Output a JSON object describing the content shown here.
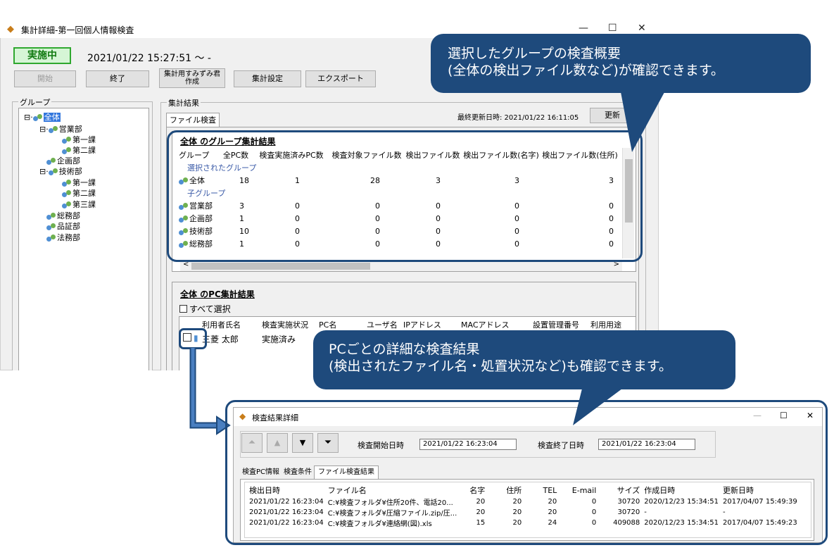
{
  "main_window": {
    "title": "集計詳細-第一回個人情報検査",
    "status": "実施中",
    "start_time": "2021/01/22 15:27:51 ～ -",
    "buttons": {
      "start": "開始",
      "end": "終了",
      "create": "集計用すみずみ君\n作成",
      "settings": "集計設定",
      "export": "エクスポート"
    },
    "group_label": "グループ",
    "tree": [
      {
        "label": "全体"
      },
      {
        "label": "営業部"
      },
      {
        "label": "第一課"
      },
      {
        "label": "第二課"
      },
      {
        "label": "企画部"
      },
      {
        "label": "技術部"
      },
      {
        "label": "第一課"
      },
      {
        "label": "第二課"
      },
      {
        "label": "第三課"
      },
      {
        "label": "総務部"
      },
      {
        "label": "品証部"
      },
      {
        "label": "法務部"
      }
    ],
    "results_label": "集計結果",
    "tab_file": "ファイル検査",
    "last_updated": "最終更新日時: 2021/01/22 16:11:05",
    "refresh": "更新",
    "group_section_title": "全体 のグループ集計結果",
    "group_table": {
      "headers": [
        "グループ",
        "全PC数",
        "検査実施済みPC数",
        "検査対象ファイル数",
        "検出ファイル数",
        "検出ファイル数(名字)",
        "検出ファイル数(住所)"
      ],
      "selected_label": "選択されたグループ",
      "selected_row": {
        "name": "全体",
        "cols": [
          "18",
          "1",
          "28",
          "3",
          "3",
          "3"
        ]
      },
      "child_label": "子グループ",
      "child_rows": [
        {
          "name": "営業部",
          "cols": [
            "3",
            "0",
            "0",
            "0",
            "0",
            "0"
          ]
        },
        {
          "name": "企画部",
          "cols": [
            "1",
            "0",
            "0",
            "0",
            "0",
            "0"
          ]
        },
        {
          "name": "技術部",
          "cols": [
            "10",
            "0",
            "0",
            "0",
            "0",
            "0"
          ]
        },
        {
          "name": "総務部",
          "cols": [
            "1",
            "0",
            "0",
            "0",
            "0",
            "0"
          ]
        }
      ]
    },
    "pc_section_title": "全体 のPC集計結果",
    "select_all": "すべて選択",
    "pc_table": {
      "headers": [
        "利用者氏名",
        "検査実施状況",
        "PC名",
        "ユーザ名",
        "IPアドレス",
        "MACアドレス",
        "設置管理番号",
        "利用用途"
      ],
      "row": {
        "user": "三菱 太郎",
        "status": "実施済み"
      }
    }
  },
  "callout_top": {
    "line1": "選択したグループの検査概要",
    "line2": "(全体の検出ファイル数など)が確認できます。"
  },
  "callout_bottom": {
    "line1": "PCごとの詳細な検査結果",
    "line2": "(検出されたファイル名・処置状況など)も確認できます。"
  },
  "detail_window": {
    "title": "検査結果詳細",
    "start_label": "検査開始日時",
    "start_value": "2021/01/22 16:23:04",
    "end_label": "検査終了日時",
    "end_value": "2021/01/22 16:23:04",
    "tabs": [
      "検査PC情報",
      "検査条件",
      "ファイル検査結果"
    ],
    "headers": [
      "検出日時",
      "ファイル名",
      "名字",
      "住所",
      "TEL",
      "E-mail",
      "サイズ",
      "作成日時",
      "更新日時"
    ],
    "rows": [
      [
        "2021/01/22 16:23:04",
        "C:¥検査フォルダ¥住所20件、電話20...",
        "20",
        "20",
        "20",
        "0",
        "30720",
        "2020/12/23 15:34:51",
        "2017/04/07 15:49:39"
      ],
      [
        "2021/01/22 16:23:04",
        "C:¥検査フォルダ¥圧縮ファイル.zip/圧...",
        "20",
        "20",
        "20",
        "0",
        "30720",
        "-",
        "-"
      ],
      [
        "2021/01/22 16:23:04",
        "C:¥検査フォルダ¥連絡網(図).xls",
        "15",
        "20",
        "24",
        "0",
        "409088",
        "2020/12/23 15:34:51",
        "2017/04/07 15:49:23"
      ]
    ]
  },
  "colors": {
    "callout": "#1e4a7c",
    "status_green": "#2fa82f",
    "selection": "#3377dd"
  }
}
